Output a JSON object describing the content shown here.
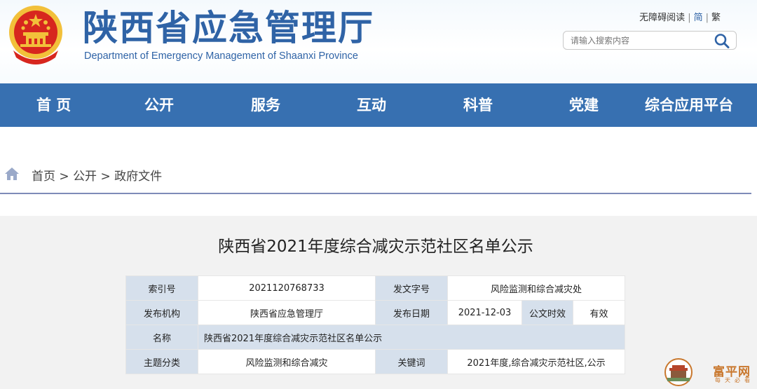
{
  "header": {
    "title_cn": "陕西省应急管理厅",
    "title_en": "Department of Emergency Management of Shaanxi Province",
    "links": {
      "accessibility": "无障碍阅读",
      "simplified": "简",
      "traditional": "繁",
      "separator": "|"
    },
    "search": {
      "placeholder": "请输入搜索内容"
    },
    "colors": {
      "brand": "#2f63a6",
      "emblem_red": "#d7261e",
      "emblem_gold": "#f2c03a"
    }
  },
  "nav": {
    "items": [
      {
        "label": "首 页"
      },
      {
        "label": "公开"
      },
      {
        "label": "服务"
      },
      {
        "label": "互动"
      },
      {
        "label": "科普"
      },
      {
        "label": "党建"
      },
      {
        "label": "综合应用平台"
      }
    ],
    "bg_color": "#3770b1"
  },
  "breadcrumb": {
    "items": [
      "首页",
      "公开",
      "政府文件"
    ],
    "separator": ">"
  },
  "document": {
    "title": "陕西省2021年度综合减灾示范社区名单公示",
    "meta": {
      "index_label": "索引号",
      "index_value": "2021120768733",
      "doc_no_label": "发文字号",
      "doc_no_value": "风险监测和综合减灾处",
      "issuer_label": "发布机构",
      "issuer_value": "陕西省应急管理厅",
      "date_label": "发布日期",
      "date_value": "2021-12-03",
      "validity_label": "公文时效",
      "validity_value": "有效",
      "name_label": "名称",
      "name_value": "陕西省2021年度综合减灾示范社区名单公示",
      "topic_label": "主题分类",
      "topic_value": "风险监测和综合减灾",
      "keywords_label": "关键词",
      "keywords_value": "2021年度,综合减灾示范社区,公示"
    }
  },
  "watermark": {
    "text": "富平网",
    "sub": "每天必看"
  }
}
